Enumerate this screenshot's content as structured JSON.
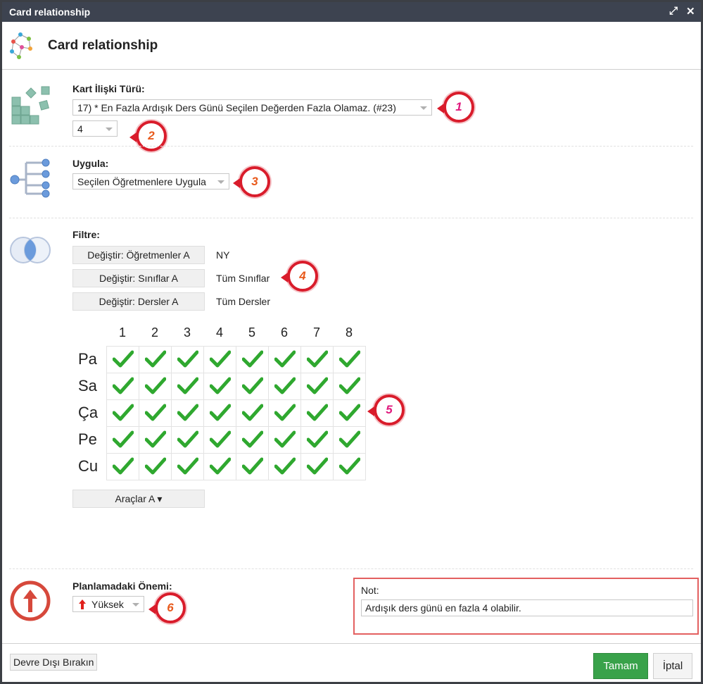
{
  "window": {
    "title": "Card relationship"
  },
  "header": {
    "title": "Card relationship"
  },
  "relation": {
    "label": "Kart İlişki Türü:",
    "type_value": "17) * En Fazla Ardışık Ders Günü Seçilen Değerden Fazla Olamaz. (#23)",
    "count_value": "4"
  },
  "apply": {
    "label": "Uygula:",
    "value": "Seçilen Öğretmenlere Uygula"
  },
  "filter": {
    "label": "Filtre:",
    "rows": [
      {
        "button": "Değiştir: Öğretmenler A",
        "value": "NY"
      },
      {
        "button": "Değiştir: Sınıflar A",
        "value": "Tüm Sınıflar"
      },
      {
        "button": "Değiştir: Dersler A",
        "value": "Tüm Dersler"
      }
    ]
  },
  "grid": {
    "columns": [
      "1",
      "2",
      "3",
      "4",
      "5",
      "6",
      "7",
      "8"
    ],
    "rows": [
      "Pa",
      "Sa",
      "Ça",
      "Pe",
      "Cu"
    ],
    "all_checked": true
  },
  "tools": {
    "label": "Araçlar A ▾"
  },
  "importance": {
    "label": "Planlamadaki Önemi:",
    "value": "Yüksek",
    "icon": "red-up-arrow"
  },
  "note": {
    "label": "Not:",
    "value": "Ardışık ders günü en fazla 4 olabilir."
  },
  "footer": {
    "disable_label": "Devre Dışı Bırakın",
    "ok_label": "Tamam",
    "cancel_label": "İptal"
  },
  "badges": [
    "1",
    "2",
    "3",
    "4",
    "5",
    "6"
  ],
  "colors": {
    "titlebar": "#3d4350",
    "badge_ring": "#d91c2b",
    "check": "#2fa82f",
    "ok_button": "#39a24a",
    "note_border": "#e36060"
  }
}
